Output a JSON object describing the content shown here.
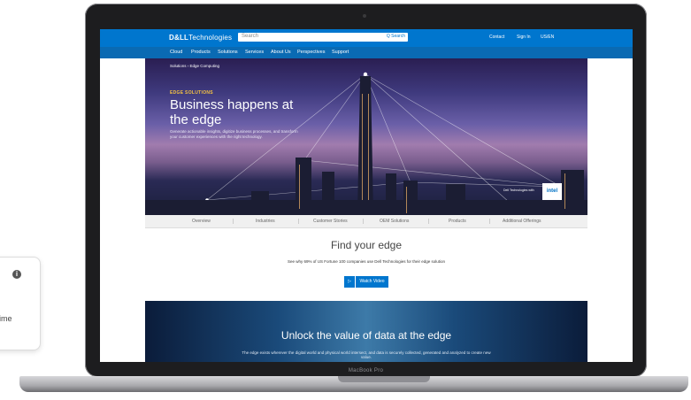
{
  "float_card": {
    "info_icon": "info-icon",
    "text": "ime"
  },
  "device": {
    "model_label": "MacBook Pro"
  },
  "site": {
    "logo_bold": "D&LL",
    "logo_rest": "Technologies",
    "search_placeholder": "Search",
    "search_button": "Q Search",
    "util": {
      "contact": "Contact",
      "signin": "Sign In",
      "region": "US/EN"
    },
    "nav": [
      "Cloud",
      "Products",
      "Solutions",
      "Services",
      "About Us",
      "Perspectives",
      "Support"
    ]
  },
  "hero": {
    "breadcrumb": "Solutions  ›  Edge Computing",
    "eyebrow": "EDGE SOLUTIONS",
    "headline": "Business happens at the edge",
    "description": "Generate actionable insights, digitize business processes, and transform your customer experiences with the right technology.",
    "badge": "intel",
    "badge_note": "Dell Technologies with"
  },
  "subtabs": [
    "Overview",
    "Industries",
    "Customer Stories",
    "OEM Solutions",
    "Products",
    "Additional Offerings"
  ],
  "find": {
    "title": "Find your edge",
    "subtitle": "See why 69% of US Fortune 100 companies use Dell Technologies for their edge solution",
    "play_icon": "▷",
    "watch_label": "Watch Video"
  },
  "band": {
    "title": "Unlock the value of data at the edge",
    "text": "The edge exists wherever the digital world and physical world intersect, and data is securely collected, generated and analyzed to create new value."
  }
}
